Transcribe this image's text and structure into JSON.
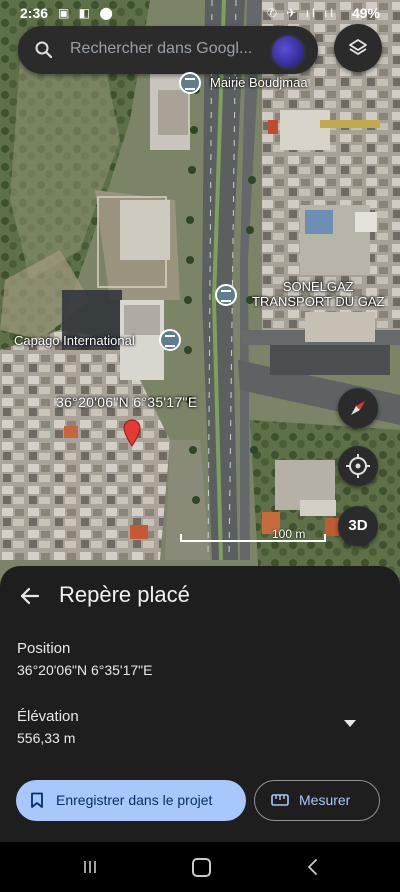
{
  "status_bar": {
    "time": "2:36",
    "notification_icons": "▣ ◧ ⬤",
    "system_icons": "✆ ✈ ıl ıl",
    "battery": "49%"
  },
  "search": {
    "placeholder": "Rechercher dans Googl...",
    "search_icon": "search-icon",
    "layers_icon": "layers-icon"
  },
  "map": {
    "labels": {
      "mairie": "Mairie Boudjmaa",
      "sonelgaz": "SONELGAZ\nTRANSPORT DU GAZ",
      "capago": "Capago International"
    },
    "coordinates_label": "36°20'06\"N 6°35'17\"E",
    "three_d_label": "3D",
    "scale_label": "100 m"
  },
  "panel": {
    "title": "Repère placé",
    "position_label": "Position",
    "position_value": "36°20'06\"N 6°35'17\"E",
    "elevation_label": "Élévation",
    "elevation_value": "556,33 m",
    "save_button": "Enregistrer dans le projet",
    "measure_button": "Mesurer"
  },
  "colors": {
    "save_bg": "#a8c7fa",
    "accent_text": "#a8c7fa",
    "panel_bg": "#1e1e1e",
    "pin": "#e53935"
  }
}
